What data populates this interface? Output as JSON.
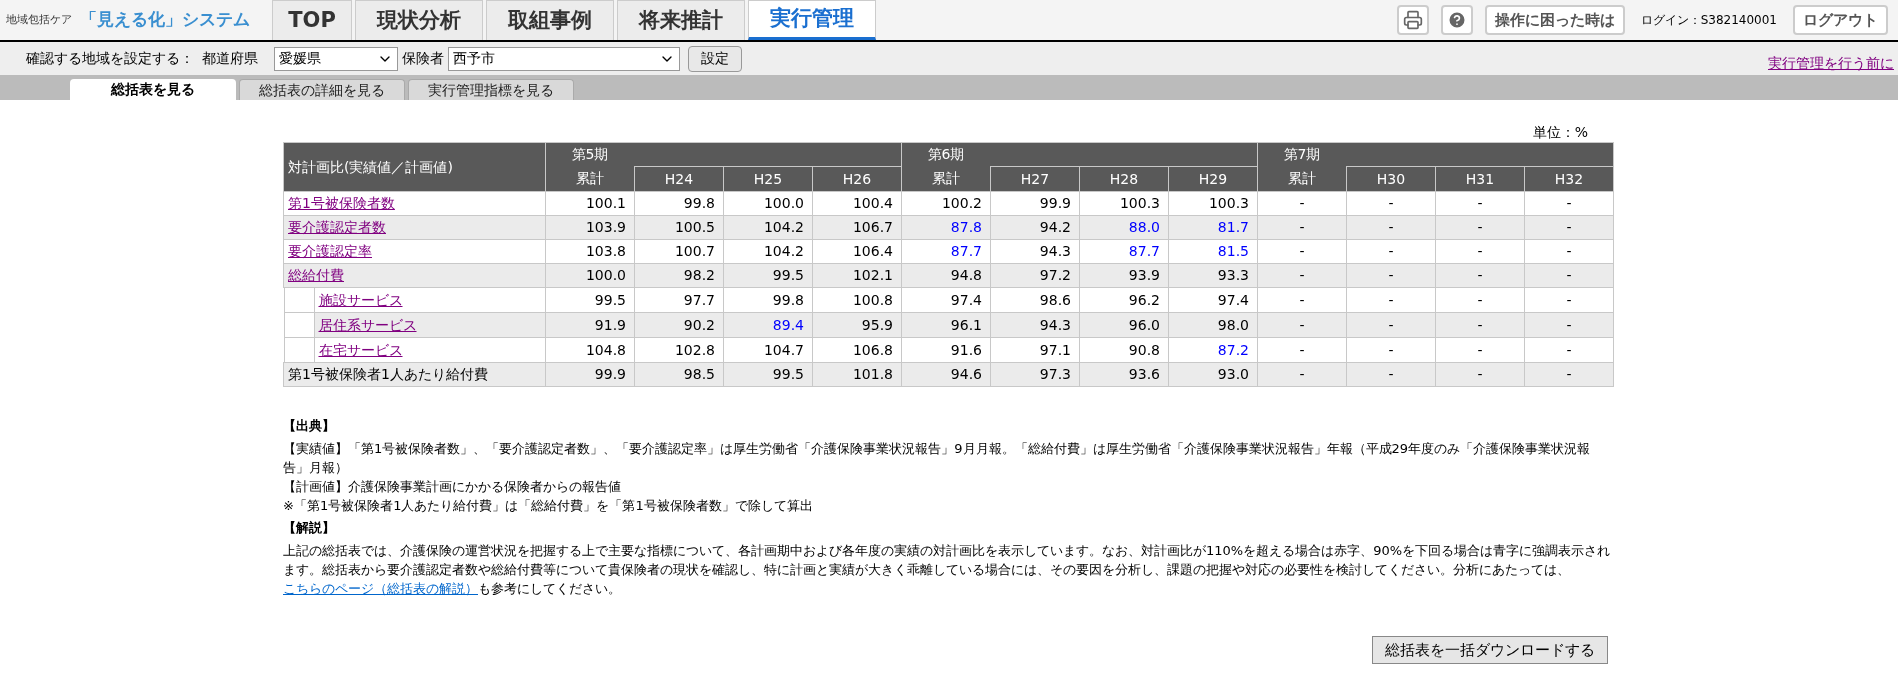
{
  "header": {
    "logo_small": "地域包括ケア",
    "logo_main": "「見える化」システム",
    "nav_tabs": [
      {
        "label": "TOP",
        "selected": false
      },
      {
        "label": "現状分析",
        "selected": false
      },
      {
        "label": "取組事例",
        "selected": false
      },
      {
        "label": "将来推計",
        "selected": false
      },
      {
        "label": "実行管理",
        "selected": true
      }
    ],
    "help_button": "操作に困った時は",
    "login": "ログイン：S382140001",
    "logout_button": "ログアウト"
  },
  "filter": {
    "label": "確認する地域を設定する：",
    "prefecture_label": "都道府県",
    "prefecture": "愛媛県",
    "insurer_label": "保険者",
    "insurer": "西予市",
    "set_button": "設定",
    "side_link": "実行管理を行う前に"
  },
  "sub_tabs": [
    {
      "label": "総括表を見る",
      "selected": true
    },
    {
      "label": "総括表の詳細を見る",
      "selected": false
    },
    {
      "label": "実行管理指標を見る",
      "selected": false
    }
  ],
  "unit": "単位：%",
  "table": {
    "corner": "対計画比(実績値／計画値)",
    "periods": [
      {
        "name": "第5期",
        "total": "累計",
        "years": [
          "H24",
          "H25",
          "H26"
        ]
      },
      {
        "name": "第6期",
        "total": "累計",
        "years": [
          "H27",
          "H28",
          "H29"
        ]
      },
      {
        "name": "第7期",
        "total": "累計",
        "years": [
          "H30",
          "H31",
          "H32"
        ]
      }
    ],
    "rows": [
      {
        "label": "第1号被保険者数",
        "link": true,
        "values": [
          {
            "text": "100.1",
            "below_plan": false
          },
          {
            "text": "99.8",
            "below_plan": false
          },
          {
            "text": "100.0",
            "below_plan": false
          },
          {
            "text": "100.4",
            "below_plan": false
          },
          {
            "text": "100.2",
            "below_plan": false
          },
          {
            "text": "99.9",
            "below_plan": false
          },
          {
            "text": "100.3",
            "below_plan": false
          },
          {
            "text": "100.3",
            "below_plan": false
          },
          {
            "text": "-",
            "below_plan": false
          },
          {
            "text": "-",
            "below_plan": false
          },
          {
            "text": "-",
            "below_plan": false
          },
          {
            "text": "-",
            "below_plan": false
          }
        ]
      },
      {
        "label": "要介護認定者数",
        "link": true,
        "values": [
          {
            "text": "103.9",
            "below_plan": false
          },
          {
            "text": "100.5",
            "below_plan": false
          },
          {
            "text": "104.2",
            "below_plan": false
          },
          {
            "text": "106.7",
            "below_plan": false
          },
          {
            "text": "87.8",
            "below_plan": true
          },
          {
            "text": "94.2",
            "below_plan": false
          },
          {
            "text": "88.0",
            "below_plan": true
          },
          {
            "text": "81.7",
            "below_plan": true
          },
          {
            "text": "-",
            "below_plan": false
          },
          {
            "text": "-",
            "below_plan": false
          },
          {
            "text": "-",
            "below_plan": false
          },
          {
            "text": "-",
            "below_plan": false
          }
        ]
      },
      {
        "label": "要介護認定率",
        "link": true,
        "values": [
          {
            "text": "103.8",
            "below_plan": false
          },
          {
            "text": "100.7",
            "below_plan": false
          },
          {
            "text": "104.2",
            "below_plan": false
          },
          {
            "text": "106.4",
            "below_plan": false
          },
          {
            "text": "87.7",
            "below_plan": true
          },
          {
            "text": "94.3",
            "below_plan": false
          },
          {
            "text": "87.7",
            "below_plan": true
          },
          {
            "text": "81.5",
            "below_plan": true
          },
          {
            "text": "-",
            "below_plan": false
          },
          {
            "text": "-",
            "below_plan": false
          },
          {
            "text": "-",
            "below_plan": false
          },
          {
            "text": "-",
            "below_plan": false
          }
        ]
      },
      {
        "label": "総給付費",
        "link": true,
        "values": [
          {
            "text": "100.0",
            "below_plan": false
          },
          {
            "text": "98.2",
            "below_plan": false
          },
          {
            "text": "99.5",
            "below_plan": false
          },
          {
            "text": "102.1",
            "below_plan": false
          },
          {
            "text": "94.8",
            "below_plan": false
          },
          {
            "text": "97.2",
            "below_plan": false
          },
          {
            "text": "93.9",
            "below_plan": false
          },
          {
            "text": "93.3",
            "below_plan": false
          },
          {
            "text": "-",
            "below_plan": false
          },
          {
            "text": "-",
            "below_plan": false
          },
          {
            "text": "-",
            "below_plan": false
          },
          {
            "text": "-",
            "below_plan": false
          }
        ],
        "children": [
          {
            "label": "施設サービス",
            "link": true,
            "values": [
              {
                "text": "99.5",
                "below_plan": false
              },
              {
                "text": "97.7",
                "below_plan": false
              },
              {
                "text": "99.8",
                "below_plan": false
              },
              {
                "text": "100.8",
                "below_plan": false
              },
              {
                "text": "97.4",
                "below_plan": false
              },
              {
                "text": "98.6",
                "below_plan": false
              },
              {
                "text": "96.2",
                "below_plan": false
              },
              {
                "text": "97.4",
                "below_plan": false
              },
              {
                "text": "-",
                "below_plan": false
              },
              {
                "text": "-",
                "below_plan": false
              },
              {
                "text": "-",
                "below_plan": false
              },
              {
                "text": "-",
                "below_plan": false
              }
            ]
          },
          {
            "label": "居住系サービス",
            "link": true,
            "values": [
              {
                "text": "91.9",
                "below_plan": false
              },
              {
                "text": "90.2",
                "below_plan": false
              },
              {
                "text": "89.4",
                "below_plan": true
              },
              {
                "text": "95.9",
                "below_plan": false
              },
              {
                "text": "96.1",
                "below_plan": false
              },
              {
                "text": "94.3",
                "below_plan": false
              },
              {
                "text": "96.0",
                "below_plan": false
              },
              {
                "text": "98.0",
                "below_plan": false
              },
              {
                "text": "-",
                "below_plan": false
              },
              {
                "text": "-",
                "below_plan": false
              },
              {
                "text": "-",
                "below_plan": false
              },
              {
                "text": "-",
                "below_plan": false
              }
            ]
          },
          {
            "label": "在宅サービス",
            "link": true,
            "values": [
              {
                "text": "104.8",
                "below_plan": false
              },
              {
                "text": "102.8",
                "below_plan": false
              },
              {
                "text": "104.7",
                "below_plan": false
              },
              {
                "text": "106.8",
                "below_plan": false
              },
              {
                "text": "91.6",
                "below_plan": false
              },
              {
                "text": "97.1",
                "below_plan": false
              },
              {
                "text": "90.8",
                "below_plan": false
              },
              {
                "text": "87.2",
                "below_plan": true
              },
              {
                "text": "-",
                "below_plan": false
              },
              {
                "text": "-",
                "below_plan": false
              },
              {
                "text": "-",
                "below_plan": false
              },
              {
                "text": "-",
                "below_plan": false
              }
            ]
          }
        ]
      },
      {
        "label": "第1号被保険者1人あたり給付費",
        "link": false,
        "values": [
          {
            "text": "99.9",
            "below_plan": false
          },
          {
            "text": "98.5",
            "below_plan": false
          },
          {
            "text": "99.5",
            "below_plan": false
          },
          {
            "text": "101.8",
            "below_plan": false
          },
          {
            "text": "94.6",
            "below_plan": false
          },
          {
            "text": "97.3",
            "below_plan": false
          },
          {
            "text": "93.6",
            "below_plan": false
          },
          {
            "text": "93.0",
            "below_plan": false
          },
          {
            "text": "-",
            "below_plan": false
          },
          {
            "text": "-",
            "below_plan": false
          },
          {
            "text": "-",
            "below_plan": false
          },
          {
            "text": "-",
            "below_plan": false
          }
        ]
      }
    ]
  },
  "notes": [
    {
      "kind": "heading",
      "text": "【出典】"
    },
    {
      "kind": "paragraph",
      "text": "【実績値】「第1号被保険者数」、「要介護認定者数」、「要介護認定率」は厚生労働省「介護保険事業状況報告」9月月報。「総給付費」は厚生労働省「介護保険事業状況報告」年報（平成29年度のみ「介護保険事業状況報告」月報）"
    },
    {
      "kind": "paragraph",
      "text": "【計画値】介護保険事業計画にかかる保険者からの報告値"
    },
    {
      "kind": "paragraph",
      "text": "※「第1号被保険者1人あたり給付費」は「総給付費」を「第1号被保険者数」で除して算出"
    },
    {
      "kind": "heading",
      "text": "【解説】"
    },
    {
      "kind": "linked",
      "text": "上記の総括表では、介護保険の運営状況を把握する上で主要な指標について、各計画期中および各年度の実績の対計画比を表示しています。なお、対計画比が110%を超える場合は赤字、90%を下回る場合は青字に強調表示されます。総括表から要介護認定者数や総給付費等について貴保険者の現状を確認し、特に計画と実績が大きく乖離している場合には、その要因を分析し、課題の把握や対応の必要性を検討してください。分析にあたっては、",
      "link": "こちらのページ（総括表の解説）",
      "after": "も参考にしてください。"
    }
  ],
  "download_button": "総括表を一括ダウンロードする"
}
